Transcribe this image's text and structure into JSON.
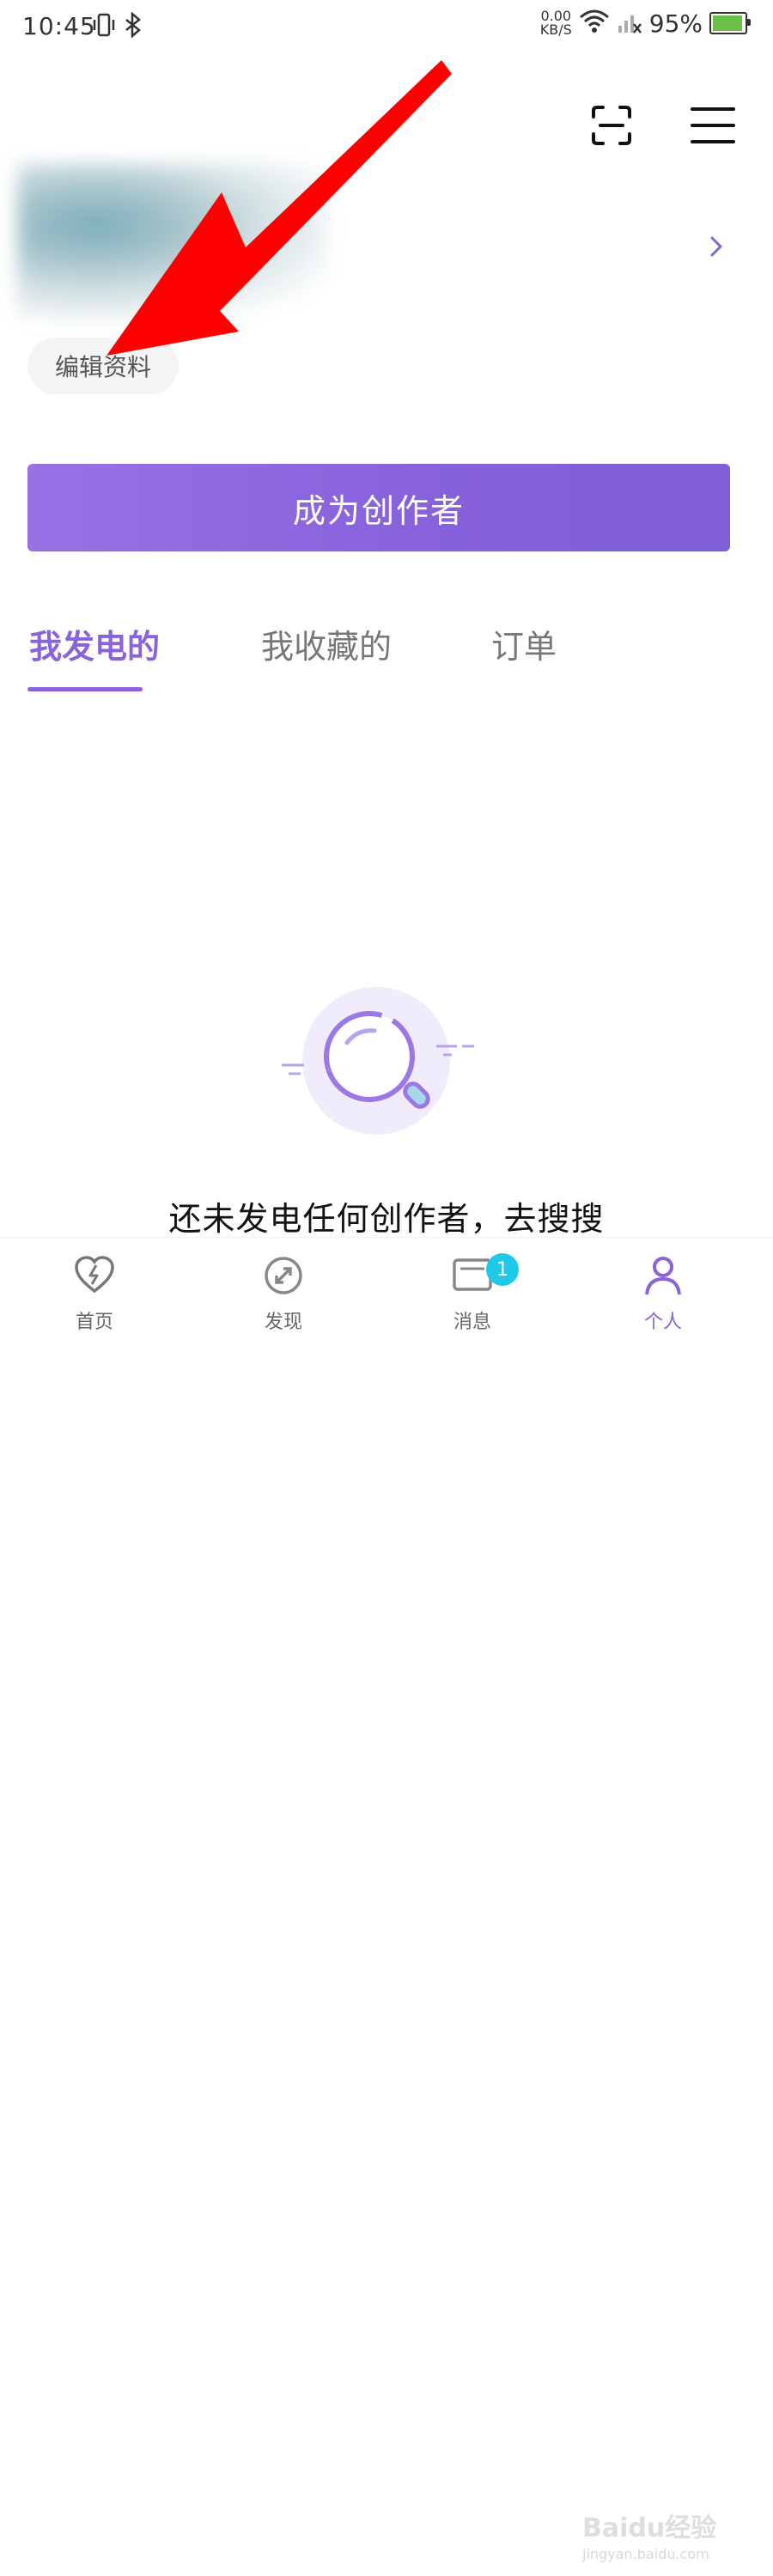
{
  "status_bar": {
    "time": "10:45",
    "net_speed_value": "0.00",
    "net_speed_unit": "KB/S",
    "battery_percent": "95%",
    "battery_level": 0.95,
    "icons": [
      "vibrate-icon",
      "bluetooth-icon",
      "wifi-icon",
      "signal-off-icon",
      "battery-icon"
    ]
  },
  "header": {
    "icons": [
      "scan-icon",
      "menu-icon"
    ]
  },
  "profile": {
    "edit_label": "编辑资料",
    "chevron_icon": "chevron-right-icon"
  },
  "creator_button": {
    "label": "成为创作者"
  },
  "tabs": [
    {
      "label": "我发电的",
      "active": true
    },
    {
      "label": "我收藏的",
      "active": false
    },
    {
      "label": "订单",
      "active": false
    }
  ],
  "empty_state": {
    "icon": "magnifier-icon",
    "text": "还未发电任何创作者，去搜搜"
  },
  "bottom_nav": [
    {
      "label": "首页",
      "icon": "heart-bolt-icon"
    },
    {
      "label": "发现",
      "icon": "discover-icon"
    },
    {
      "label": "消息",
      "icon": "message-icon",
      "badge": "1"
    },
    {
      "label": "个人",
      "icon": "person-icon",
      "active": true
    }
  ],
  "watermark": {
    "brand": "Baidu经验",
    "url": "jingyan.baidu.com"
  },
  "colors": {
    "accent": "#8a62dc",
    "button_gradient_start": "#9871e4",
    "button_gradient_end": "#7f5fd6",
    "badge": "#20c8e8",
    "annotation_arrow": "#ff0000"
  }
}
